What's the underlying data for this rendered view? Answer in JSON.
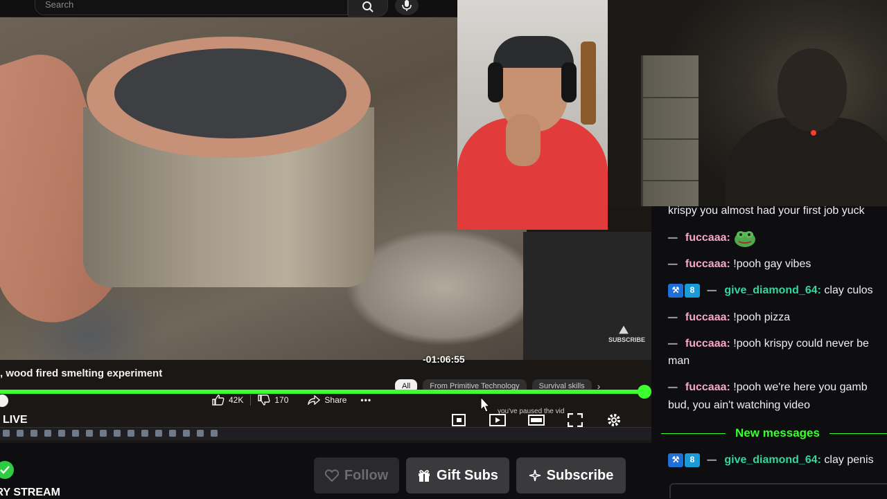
{
  "search": {
    "placeholder": "Search"
  },
  "video": {
    "title": ", wood fired smelting experiment",
    "timecode": "-01:06:55",
    "watermark": "SUBSCRIBE",
    "progress_fraction": 0.99,
    "chips": [
      {
        "label": "All",
        "active": true
      },
      {
        "label": "From Primitive Technology",
        "active": false
      },
      {
        "label": "Survival skills",
        "active": false
      }
    ],
    "likes": "42K",
    "dislikes": "170",
    "share_label": "Share",
    "live_label": "LIVE",
    "toast": "you've paused the vid"
  },
  "channel": {
    "name": "CRY STREAM",
    "follow_label": "Follow",
    "gift_label": "Gift Subs",
    "subscribe_label": "Subscribe"
  },
  "chat": {
    "messages": [
      {
        "user": "",
        "text": "krispy you almost had your first job yuck"
      },
      {
        "user": "fuccaaa",
        "color": "#f7a8c8",
        "text": "",
        "emote": "pepe-emote",
        "badges": []
      },
      {
        "user": "fuccaaa",
        "color": "#f7a8c8",
        "text": " !pooh gay vibes",
        "badges": []
      },
      {
        "user": "give_diamond_64",
        "color": "#35d6a0",
        "text": " clay culos",
        "badges": [
          "hammer-badge",
          "8s-badge"
        ]
      },
      {
        "user": "fuccaaa",
        "color": "#f7a8c8",
        "text": " !pooh pizza",
        "badges": []
      },
      {
        "user": "fuccaaa",
        "color": "#f7a8c8",
        "text": " !pooh krispy could never be",
        "cont": "man",
        "badges": []
      },
      {
        "user": "fuccaaa",
        "color": "#f7a8c8",
        "text": " !pooh we're here you gamb",
        "cont": "bud, you ain't watching video",
        "badges": []
      }
    ],
    "new_messages_label": "New messages",
    "after": {
      "user": "give_diamond_64",
      "color": "#35d6a0",
      "text": " clay penis",
      "badges": [
        "hammer-badge",
        "8s-badge"
      ]
    }
  },
  "colors": {
    "accent": "#3bff2e",
    "chat_user_pink": "#f7a8c8",
    "chat_user_teal": "#35d6a0"
  }
}
